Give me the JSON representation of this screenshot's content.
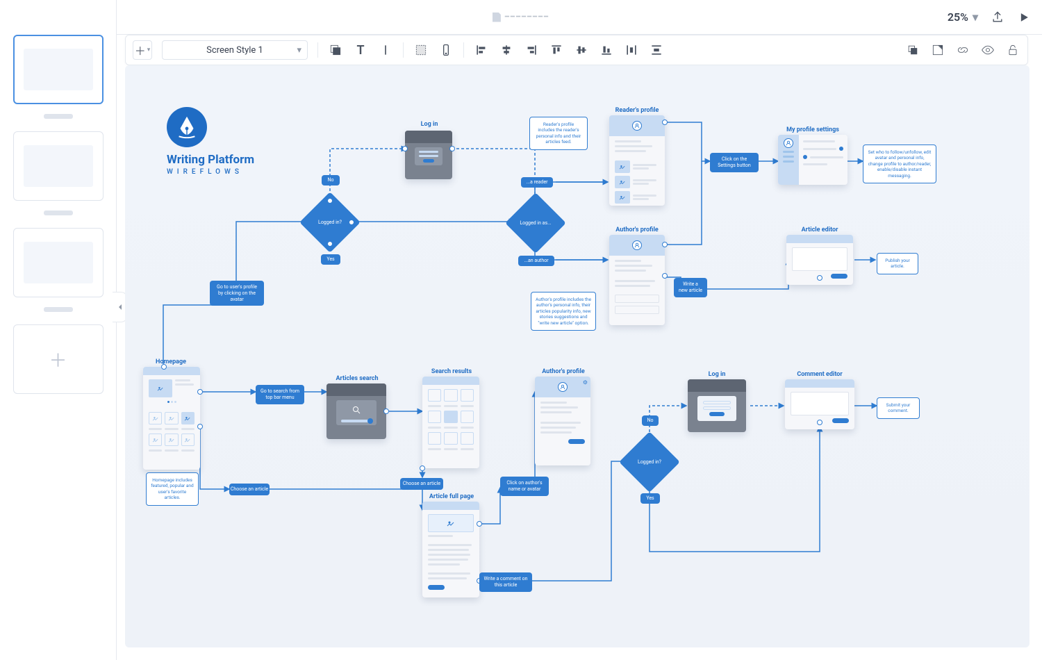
{
  "app": {
    "doc_title": "━━━━━━━━",
    "zoom": "25%"
  },
  "toolbar": {
    "style": "Screen Style 1"
  },
  "logo": {
    "title": "Writing Platform",
    "subtitle": "WIREFLOWS"
  },
  "flow": {
    "labels": {
      "log_in_top": "Log in",
      "readers_profile": "Reader's profile",
      "my_profile_settings": "My profile settings",
      "authors_profile": "Author's profile",
      "article_editor": "Article editor",
      "homepage": "Homepage",
      "articles_search": "Articles search",
      "search_results": "Search results",
      "authors_profile_2": "Author's profile",
      "log_in_bottom": "Log in",
      "comment_editor": "Comment editor",
      "article_full": "Article full page"
    },
    "decisions": {
      "logged_in": "Logged in?",
      "logged_in_as": "Logged in as...",
      "logged_in_2": "Logged in?",
      "no": "No",
      "yes": "Yes",
      "a_reader": "...a reader",
      "an_author": "...an author",
      "no_2": "No",
      "yes_2": "Yes"
    },
    "actions": {
      "go_to_profile": "Go to user's profile by clicking on the avatar",
      "click_settings": "Click on the Settings button",
      "write_new_article": "Write a new article",
      "go_to_search": "Go to search from top bar menu",
      "choose_article_1": "Choose an article",
      "choose_article_2": "Choose an article",
      "click_author_avatar": "Click on author's name or avatar",
      "write_comment": "Write a comment on this article",
      "publish": "Publish your article.",
      "submit_comment": "Submit your comment."
    },
    "notes": {
      "reader_profile_note": "Reader's profile includes the reader's personal info and their articles feed.",
      "settings_note": "Set who to follow/unfollow, edit avatar and personal info, change profile to author/reader, enable/disable instant messaging.",
      "author_profile_note": "Author's profile includes the author's personal info, their articles popularity info, new stories suggestions and \"write new article\" option.",
      "homepage_note": "Homepage includes featured, popular and user's favorite articles."
    }
  }
}
